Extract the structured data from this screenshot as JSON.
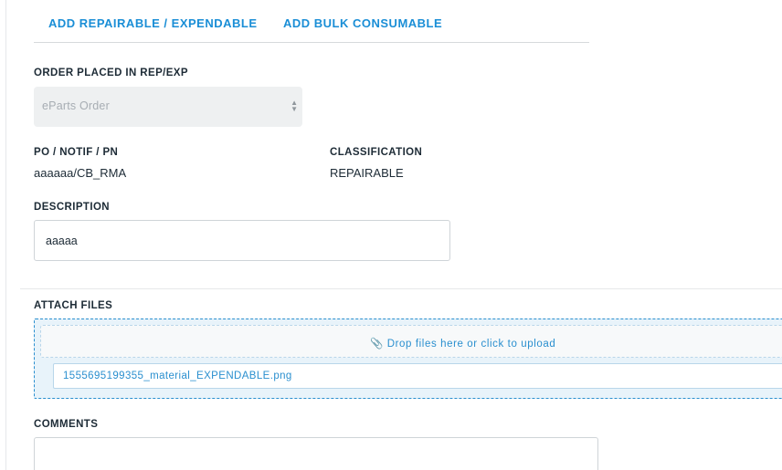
{
  "tabs": [
    {
      "label": "ADD REPAIRABLE / EXPENDABLE"
    },
    {
      "label": "ADD BULK CONSUMABLE"
    }
  ],
  "order": {
    "label": "ORDER PLACED IN REP/EXP",
    "selected": "eParts Order"
  },
  "po": {
    "label": "PO / NOTIF / PN",
    "value": "aaaaaa/CB_RMA"
  },
  "classification": {
    "label": "CLASSIFICATION",
    "value": "REPAIRABLE"
  },
  "description": {
    "label": "DESCRIPTION",
    "value": "aaaaa"
  },
  "attach": {
    "label": "ATTACH FILES",
    "icon": "paperclip-icon",
    "prompt": "Drop files here or click to upload",
    "file_name": "1555695199355_material_EXPENDABLE.png"
  },
  "comments": {
    "label": "COMMENTS",
    "value": ""
  },
  "colors": {
    "accent": "#1a8ed6",
    "text": "#1d2b36",
    "dropzone_bg": "#e8f3fa"
  }
}
